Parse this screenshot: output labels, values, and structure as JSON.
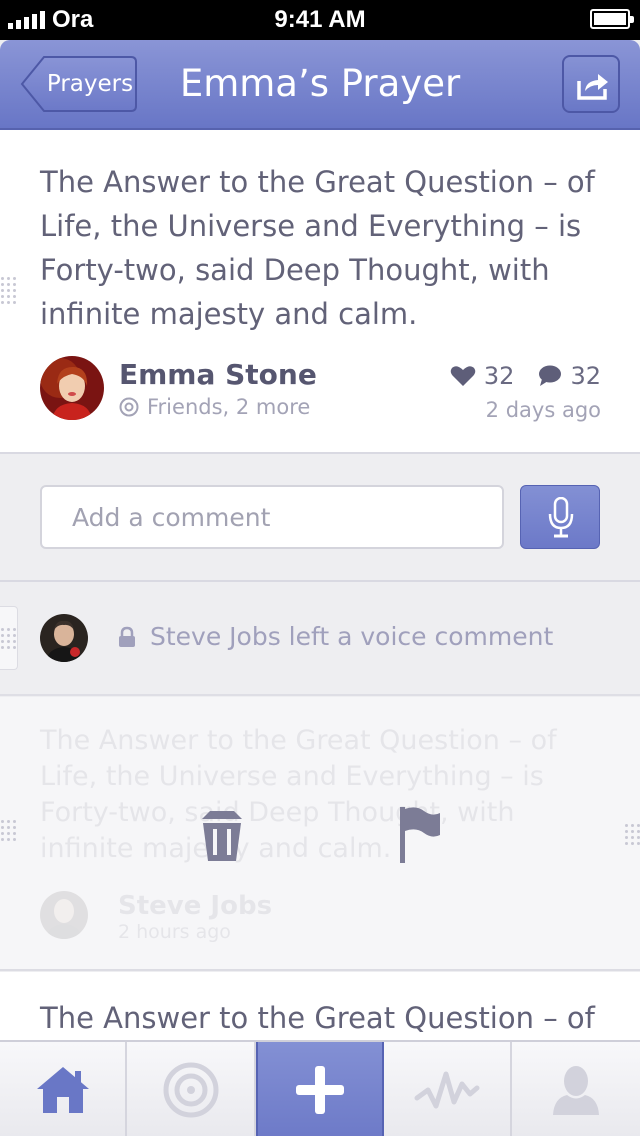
{
  "status_bar": {
    "carrier": "Ora",
    "time": "9:41 AM"
  },
  "nav": {
    "back_label": "Prayers",
    "title": "Emma’s Prayer",
    "share_icon": "share-icon"
  },
  "prayer": {
    "text": "The Answer to the Great Question – of Life, the Universe and Everything – is Forty-two, said Deep Thought, with infinite majesty and calm.",
    "author": "Emma Stone",
    "audience": "Friends, 2 more",
    "likes": "32",
    "comments": "32",
    "time": "2 days ago"
  },
  "comment_box": {
    "placeholder": "Add a comment",
    "mic_icon": "microphone-icon"
  },
  "voice_comment": {
    "text": "Steve Jobs left a voice comment",
    "lock_icon": "lock-icon"
  },
  "swiped_comment": {
    "text": "The Answer to the Great Question – of Life, the Universe and Everything – is Forty-two, said Deep Thought, with infinite majesty and calm.",
    "author": "Steve Jobs",
    "time": "2 hours ago",
    "actions": [
      "trash-icon",
      "flag-icon"
    ]
  },
  "next_card": {
    "text": "The Answer to the Great Question – of Life, the Universe and Everything –"
  },
  "tabs": [
    {
      "icon": "home-icon"
    },
    {
      "icon": "target-icon"
    },
    {
      "icon": "plus-icon",
      "active": true
    },
    {
      "icon": "activity-icon"
    },
    {
      "icon": "person-icon"
    }
  ],
  "colors": {
    "accent": "#7381cc",
    "text": "#626278",
    "muted": "#a3a3b6"
  }
}
